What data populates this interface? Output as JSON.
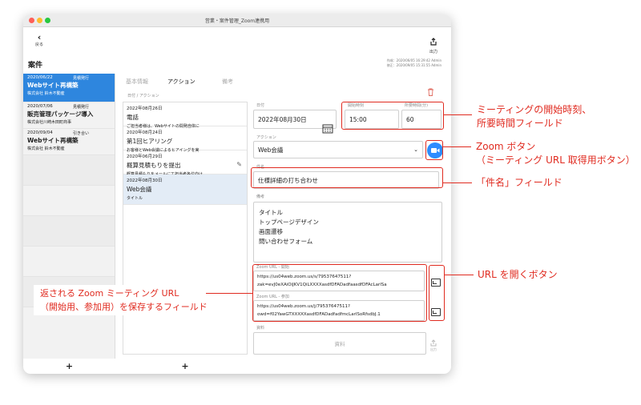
{
  "window": {
    "title": "営業・案件管理_Zoom連携用"
  },
  "toolbar": {
    "back_label": "戻る",
    "export_label": "出力"
  },
  "section": {
    "title": "案件",
    "created": "作成：2020/06/05 16:29:42 Admin",
    "updated": "修正：2020/09/05 15:31:55 Admin"
  },
  "projects": [
    {
      "date": "2020/06/22",
      "status": "見積発行",
      "title": "Webサイト再構築",
      "company": "株式会社 鈴木不動産"
    },
    {
      "date": "2020/07/06",
      "status": "見積発行",
      "title": "販売管理パッケージ導入",
      "company": "株式会社川崎木田町商事"
    },
    {
      "date": "2020/09/04",
      "status": "引き合い",
      "title": "Webサイト再構築",
      "company": "株式会社 鈴木不動産"
    }
  ],
  "tabs": {
    "basic": "基本情報",
    "action": "アクション",
    "notes": "備考"
  },
  "actions_header": "日付 / アクション",
  "actions": [
    {
      "date": "2022年08月26日",
      "title": "電話",
      "desc": "ご担当者様は、Webサイトの間発自体に"
    },
    {
      "date": "2020年08月24日",
      "title": "第1回ヒアリング",
      "desc": "お客様とWeb会議によるヒアイングを実"
    },
    {
      "date": "2020年06月29日",
      "title": "概算見積もりを提出",
      "desc": "概算見積もりをメールにて担当者各位向け"
    },
    {
      "date": "2022年08月30日",
      "title": "Web会議",
      "desc": "タイトル"
    }
  ],
  "form": {
    "date_label": "日付",
    "date_value": "2022年08月30日",
    "start_label": "開始時刻",
    "start_value": "15:00",
    "duration_label": "所要時間(分)",
    "duration_value": "60",
    "action_label": "アクション",
    "action_value": "Web会議",
    "subject_label": "件名",
    "subject_value": "仕様詳細の打ち合わせ",
    "notes_label": "備考",
    "notes_lines": [
      "タイトル",
      "トップページデザイン",
      "画面遷移",
      "問い合わせフォーム"
    ],
    "zoom_start_label": "Zoom URL - 開始",
    "zoom_start_l1": "https://us04web.zoom.us/s/79537647511?",
    "zoom_start_l2": "zak=evJ0eXAiOiJKV1QiLXXXXasdfDFADadfaasdfDFAcLarlSa",
    "zoom_join_label": "Zoom URL - 参加",
    "zoom_join_l1": "https://us04web.zoom.us/j/79537647511?",
    "zoom_join_l2": "owd=f02YawGTXXXXXasdfDFADadfadfmcLarlSoRfsdbJ.1",
    "material_label": "資料",
    "material_placeholder": "資料",
    "upload_label": "出力"
  },
  "annotations": {
    "a1_l1": "ミーティングの開始時刻、",
    "a1_l2": "所要時間フィールド",
    "a2_l1": "Zoom ボタン",
    "a2_l2": "（ミーティング URL 取得用ボタン）",
    "a3": "「件名」フィールド",
    "a4": "URL を開くボタン",
    "a5_l1": "返される Zoom ミーティング URL",
    "a5_l2": "（開始用、参加用）を保存するフィールド"
  },
  "colors": {
    "accent": "#2e86de",
    "annotation": "#e02b20",
    "zoom": "#2d8cff"
  }
}
